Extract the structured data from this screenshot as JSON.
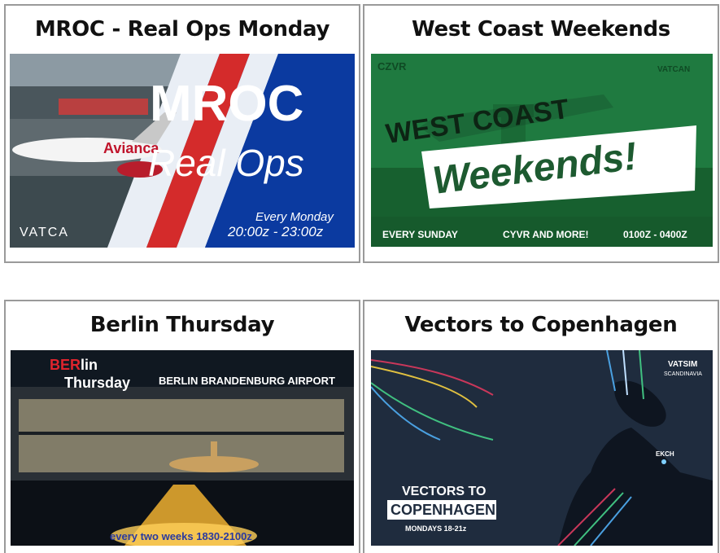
{
  "cards": [
    {
      "title": "MROC - Real Ops Monday",
      "banner": {
        "headline": "MROC",
        "subline": "Real Ops",
        "schedule_1": "Every Monday",
        "schedule_2": "20:00z - 23:00z",
        "logo": "VATCA",
        "airline": "Avianca",
        "colors": {
          "blue": "#0b3aa0",
          "red": "#d42b2b"
        }
      }
    },
    {
      "title": "West Coast Weekends",
      "banner": {
        "top_left": "CZVR",
        "top_right": "VATCAN",
        "headline": "WEST COAST",
        "script": "Weekends!",
        "footer_left": "EVERY SUNDAY",
        "footer_center": "CYVR AND MORE!",
        "footer_right": "0100Z - 0400Z",
        "colors": {
          "green": "#1f7a40"
        }
      }
    },
    {
      "title": "Berlin Thursday",
      "banner": {
        "brand_red": "BER",
        "brand": "lin",
        "day": "Thursday",
        "airport": "BERLIN BRANDENBURG AIRPORT",
        "schedule": "every two weeks 1830-2100z",
        "colors": {
          "night": "#101821",
          "glow": "#f0b030"
        }
      }
    },
    {
      "title": "Vectors to Copenhagen",
      "banner": {
        "brand": "VATSIM",
        "brand_sub": "SCANDINAVIA",
        "headline_1": "VECTORS TO",
        "headline_2": "COPENHAGEN",
        "schedule": "MONDAYS 18-21z",
        "waypoint": "EKCH",
        "colors": {
          "sea": "#1f2c3e"
        }
      }
    }
  ]
}
